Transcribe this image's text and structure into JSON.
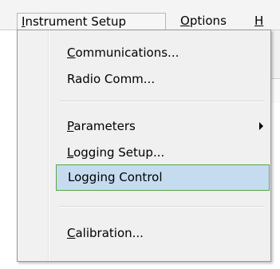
{
  "menubar": {
    "instrument_setup": {
      "pre": "",
      "u": "I",
      "post": "nstrument Setup"
    },
    "options": {
      "pre": "",
      "u": "O",
      "post": "ptions"
    },
    "help": {
      "pre": "",
      "u": "H",
      "post": ""
    }
  },
  "menu": {
    "items": [
      {
        "pre": "",
        "u": "C",
        "post": "ommunications..."
      },
      {
        "pre": "Radio Comm...",
        "u": "",
        "post": ""
      },
      {
        "pre": "",
        "u": "P",
        "post": "arameters"
      },
      {
        "pre": "",
        "u": "L",
        "post": "ogging Setup..."
      },
      {
        "pre": "Logging Control",
        "u": "",
        "post": ""
      },
      {
        "pre": "",
        "u": "C",
        "post": "alibration..."
      }
    ],
    "selected_index": 4
  },
  "icons": {
    "submenu": "chevron-right-icon"
  },
  "colors": {
    "highlight": "#c5dcf0",
    "highlight_border": "#5aa64a"
  }
}
